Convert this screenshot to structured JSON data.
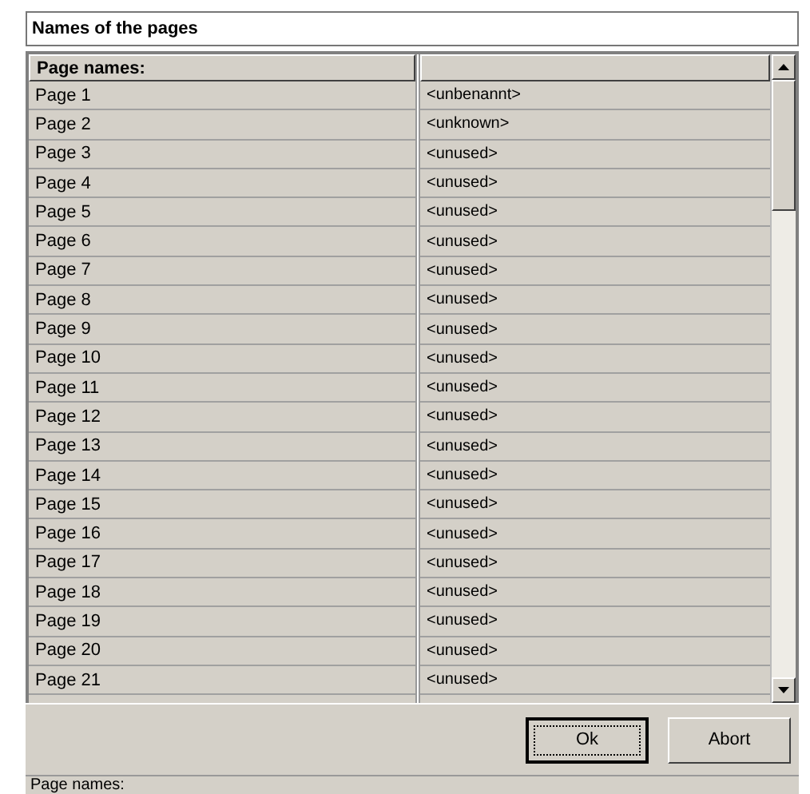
{
  "title_field": {
    "value": "Names of the pages"
  },
  "table": {
    "columns": [
      "Page names:",
      ""
    ],
    "rows": [
      [
        "Page 1",
        "<unbenannt>"
      ],
      [
        "Page 2",
        "<unknown>"
      ],
      [
        "Page 3",
        "<unused>"
      ],
      [
        "Page 4",
        "<unused>"
      ],
      [
        "Page 5",
        "<unused>"
      ],
      [
        "Page 6",
        "<unused>"
      ],
      [
        "Page 7",
        "<unused>"
      ],
      [
        "Page 8",
        "<unused>"
      ],
      [
        "Page 9",
        "<unused>"
      ],
      [
        "Page 10",
        "<unused>"
      ],
      [
        "Page 11",
        "<unused>"
      ],
      [
        "Page 12",
        "<unused>"
      ],
      [
        "Page 13",
        "<unused>"
      ],
      [
        "Page 14",
        "<unused>"
      ],
      [
        "Page 15",
        "<unused>"
      ],
      [
        "Page 16",
        "<unused>"
      ],
      [
        "Page 17",
        "<unused>"
      ],
      [
        "Page 18",
        "<unused>"
      ],
      [
        "Page 19",
        "<unused>"
      ],
      [
        "Page 20",
        "<unused>"
      ],
      [
        "Page 21",
        "<unused>"
      ]
    ]
  },
  "buttons": [
    {
      "label": "Ok",
      "default": true
    },
    {
      "label": "Abort",
      "default": false
    }
  ],
  "status_bar": "Page names:"
}
